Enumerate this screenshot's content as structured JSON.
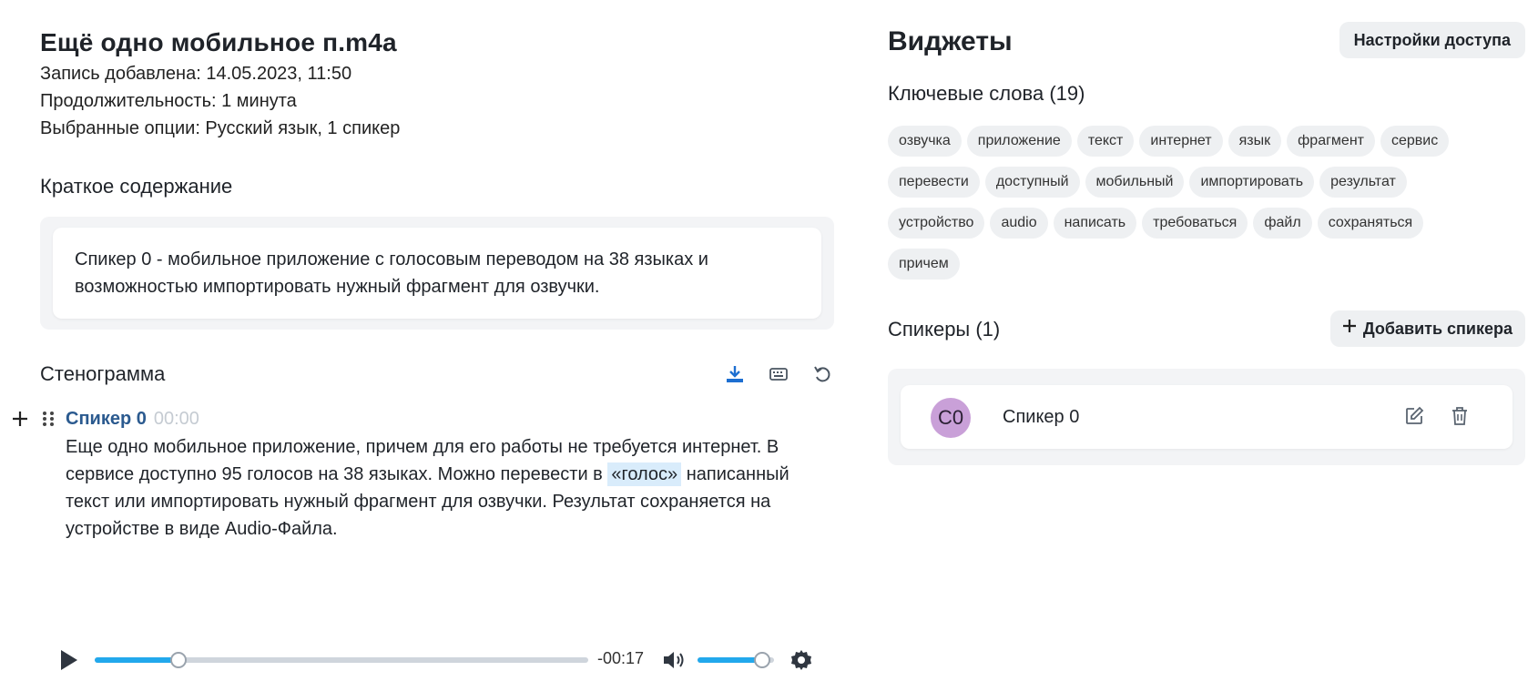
{
  "record": {
    "title": "Ещё одно мобильное п.m4a",
    "added": "Запись добавлена: 14.05.2023, 11:50",
    "duration": "Продолжительность: 1 минута",
    "options": "Выбранные опции: Русский язык, 1 спикер"
  },
  "summary": {
    "heading": "Краткое содержание",
    "text": "Спикер 0 - мобильное приложение с голосовым переводом на 38 языках и возможностью импортировать нужный фрагмент для озвучки."
  },
  "transcript": {
    "heading": "Стенограмма",
    "tools": {
      "download_icon": "download-icon",
      "keyboard_icon": "keyboard-icon",
      "undo_icon": "undo-icon"
    },
    "segment": {
      "speaker": "Спикер 0",
      "time": "00:00",
      "text_before": "Еще одно мобильное приложение, причем для его работы не требуется интернет. В сервисе доступно 95 голосов на 38 языках. Можно перевести в ",
      "highlight": "«голос»",
      "text_after": " написанный текст или импортировать нужный фрагмент для озвучки. Результат сохраняется на устройстве в виде Audio-Файла."
    }
  },
  "player": {
    "remaining": "-00:17",
    "progress": 0.17,
    "volume": 0.85,
    "accent": "#22a8ec"
  },
  "widgets": {
    "title": "Виджеты",
    "access_button": "Настройки доступа",
    "keywords": {
      "heading": "Ключевые слова (19)",
      "items": [
        "озвучка",
        "приложение",
        "текст",
        "интернет",
        "язык",
        "фрагмент",
        "сервис",
        "перевести",
        "доступный",
        "мобильный",
        "импортировать",
        "результат",
        "устройство",
        "audio",
        "написать",
        "требоваться",
        "файл",
        "сохраняться",
        "причем"
      ]
    },
    "speakers": {
      "heading": "Спикеры (1)",
      "add_button": "Добавить спикера",
      "list": [
        {
          "initials": "C0",
          "name": "Спикер 0",
          "avatar_color": "#c9a0d8"
        }
      ]
    }
  }
}
